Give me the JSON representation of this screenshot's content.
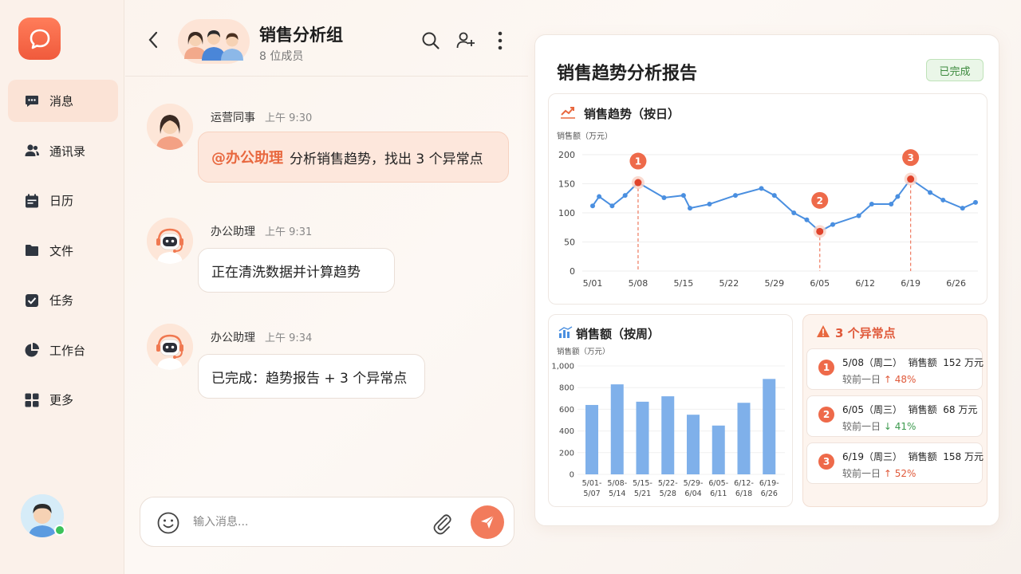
{
  "sidebar": {
    "items": [
      {
        "label": "消息",
        "icon": "chat-bubble-icon",
        "active": true
      },
      {
        "label": "通讯录",
        "icon": "contacts-icon",
        "active": false
      },
      {
        "label": "日历",
        "icon": "calendar-icon",
        "active": false
      },
      {
        "label": "文件",
        "icon": "folder-icon",
        "active": false
      },
      {
        "label": "任务",
        "icon": "checkbox-icon",
        "active": false
      },
      {
        "label": "工作台",
        "icon": "pie-chart-icon",
        "active": false
      },
      {
        "label": "更多",
        "icon": "grid-icon",
        "active": false
      }
    ]
  },
  "chat": {
    "group_name": "销售分析组",
    "member_count": "8 位成员",
    "messages": [
      {
        "sender": "运营同事",
        "time": "上午 9:30",
        "mention": "@办公助理",
        "text": "分析销售趋势，找出 3 个异常点"
      },
      {
        "sender": "办公助理",
        "time": "上午 9:31",
        "text": "正在清洗数据并计算趋势"
      },
      {
        "sender": "办公助理",
        "time": "上午 9:34",
        "text": "已完成：趋势报告 + 3 个异常点"
      }
    ],
    "composer": {
      "placeholder": "输入消息..."
    }
  },
  "report": {
    "title": "销售趋势分析报告",
    "status": "已完成",
    "line_title": "销售趋势（按日）",
    "bar_title": "销售额（按周）",
    "anomaly_title": "3 个异常点",
    "anomalies": [
      {
        "num": "1",
        "date": "5/08（周二）",
        "label": "销售额",
        "amount": "152 万元",
        "compare": "较前一日",
        "change": "↑ 48%",
        "dir": "up"
      },
      {
        "num": "2",
        "date": "6/05（周三）",
        "label": "销售额",
        "amount": "68 万元",
        "compare": "较前一日",
        "change": "↓ 41%",
        "dir": "down"
      },
      {
        "num": "3",
        "date": "6/19（周三）",
        "label": "销售额",
        "amount": "158 万元",
        "compare": "较前一日",
        "change": "↑ 52%",
        "dir": "up"
      }
    ]
  },
  "chart_data": [
    {
      "type": "line",
      "title": "销售趋势（按日）",
      "ylabel": "销售额（万元）",
      "ylim": [
        0,
        200
      ],
      "yticks": [
        0,
        50,
        100,
        150,
        200
      ],
      "xticks": [
        "5/01",
        "5/08",
        "5/15",
        "5/22",
        "5/29",
        "6/05",
        "6/12",
        "6/19",
        "6/26"
      ],
      "grid": true,
      "color": "#4a8fe0",
      "series": [
        {
          "values": [
            {
              "x": "5/01",
              "y": 112
            },
            {
              "x": "5/02",
              "y": 128
            },
            {
              "x": "5/04",
              "y": 112
            },
            {
              "x": "5/06",
              "y": 130
            },
            {
              "x": "5/08",
              "y": 152
            },
            {
              "x": "5/12",
              "y": 126
            },
            {
              "x": "5/15",
              "y": 130
            },
            {
              "x": "5/16",
              "y": 108
            },
            {
              "x": "5/19",
              "y": 115
            },
            {
              "x": "5/23",
              "y": 130
            },
            {
              "x": "5/27",
              "y": 142
            },
            {
              "x": "5/29",
              "y": 130
            },
            {
              "x": "6/01",
              "y": 100
            },
            {
              "x": "6/03",
              "y": 88
            },
            {
              "x": "6/05",
              "y": 68
            },
            {
              "x": "6/07",
              "y": 80
            },
            {
              "x": "6/11",
              "y": 95
            },
            {
              "x": "6/13",
              "y": 115
            },
            {
              "x": "6/16",
              "y": 115
            },
            {
              "x": "6/17",
              "y": 128
            },
            {
              "x": "6/19",
              "y": 158
            },
            {
              "x": "6/22",
              "y": 135
            },
            {
              "x": "6/24",
              "y": 122
            },
            {
              "x": "6/27",
              "y": 108
            },
            {
              "x": "6/29",
              "y": 118
            }
          ]
        }
      ],
      "annotations": [
        {
          "label": "1",
          "x": "5/08",
          "y": 152
        },
        {
          "label": "2",
          "x": "6/05",
          "y": 68
        },
        {
          "label": "3",
          "x": "6/19",
          "y": 158
        }
      ]
    },
    {
      "type": "bar",
      "title": "销售额（按周）",
      "ylabel": "销售额（万元）",
      "ylim": [
        0,
        1000
      ],
      "yticks": [
        0,
        200,
        400,
        600,
        800,
        1000
      ],
      "ytick_labels": [
        "0",
        "200",
        "400",
        "600",
        "800",
        "1,000"
      ],
      "categories": [
        [
          "5/01-",
          "5/07"
        ],
        [
          "5/08-",
          "5/14"
        ],
        [
          "5/15-",
          "5/21"
        ],
        [
          "5/22-",
          "5/28"
        ],
        [
          "5/29-",
          "6/04"
        ],
        [
          "6/05-",
          "6/11"
        ],
        [
          "6/12-",
          "6/18"
        ],
        [
          "6/19-",
          "6/26"
        ]
      ],
      "values": [
        640,
        830,
        670,
        720,
        550,
        450,
        660,
        880
      ],
      "color": "#7fb0ea"
    }
  ]
}
